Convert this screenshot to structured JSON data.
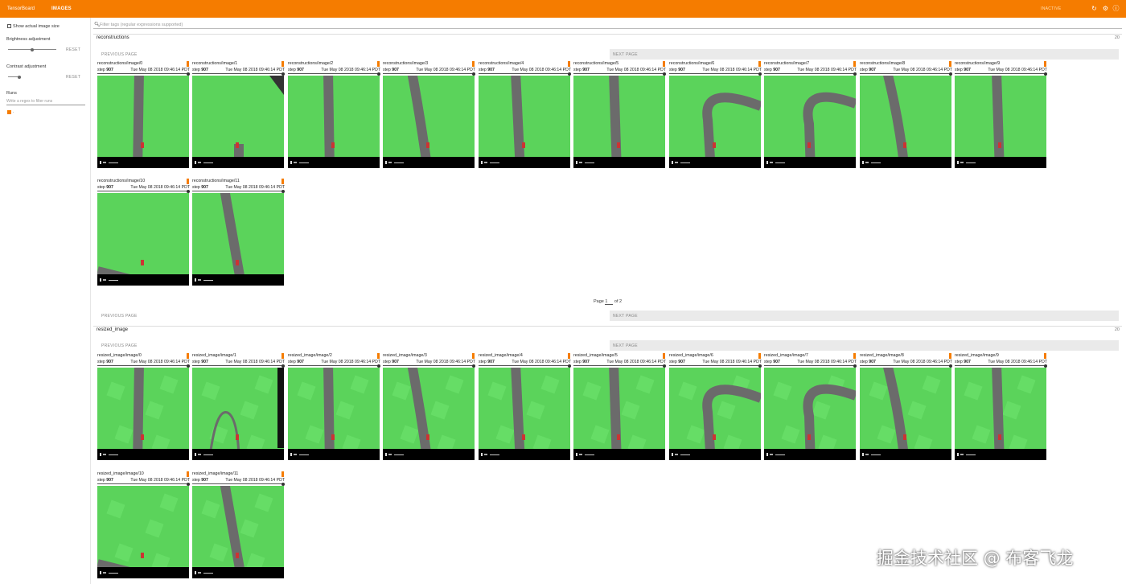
{
  "topbar": {
    "brand": "TensorBoard",
    "active_tab": "IMAGES",
    "inactive_label": "INACTIVE",
    "refresh_icon": "refresh-icon",
    "settings_icon": "gear-icon",
    "help_icon": "help-icon"
  },
  "sidebar": {
    "show_actual_size": "Show actual image size",
    "brightness_label": "Brightness adjustment",
    "brightness_reset": "RESET",
    "brightness_value": 0.5,
    "contrast_label": "Contrast adjustment",
    "contrast_reset": "RESET",
    "contrast_value": 0.5,
    "runs_label": "Runs",
    "runs_placeholder": "Write a regex to filter runs",
    "run_name": "."
  },
  "filter": {
    "placeholder": "Filter tags (regular expressions supported)"
  },
  "sections": [
    {
      "title": "reconstructions",
      "count": "20",
      "previous": "PREVIOUS PAGE",
      "next": "NEXT PAGE",
      "cards": [
        {
          "tag": "reconstructions/image/0",
          "step_label": "step",
          "step": "907",
          "time": "Tue May 08 2018 09:46:14 PDT"
        },
        {
          "tag": "reconstructions/image/1",
          "step_label": "step",
          "step": "907",
          "time": "Tue May 08 2018 09:46:14 PDT"
        },
        {
          "tag": "reconstructions/image/2",
          "step_label": "step",
          "step": "907",
          "time": "Tue May 08 2018 09:46:14 PDT"
        },
        {
          "tag": "reconstructions/image/3",
          "step_label": "step",
          "step": "907",
          "time": "Tue May 08 2018 09:46:14 PDT"
        },
        {
          "tag": "reconstructions/image/4",
          "step_label": "step",
          "step": "907",
          "time": "Tue May 08 2018 09:46:14 PDT"
        },
        {
          "tag": "reconstructions/image/5",
          "step_label": "step",
          "step": "907",
          "time": "Tue May 08 2018 09:46:14 PDT"
        },
        {
          "tag": "reconstructions/image/6",
          "step_label": "step",
          "step": "907",
          "time": "Tue May 08 2018 09:46:14 PDT"
        },
        {
          "tag": "reconstructions/image/7",
          "step_label": "step",
          "step": "907",
          "time": "Tue May 08 2018 09:46:14 PDT"
        },
        {
          "tag": "reconstructions/image/8",
          "step_label": "step",
          "step": "907",
          "time": "Tue May 08 2018 09:46:14 PDT"
        },
        {
          "tag": "reconstructions/image/9",
          "step_label": "step",
          "step": "907",
          "time": "Tue May 08 2018 09:46:14 PDT"
        },
        {
          "tag": "reconstructions/image/10",
          "step_label": "step",
          "step": "907",
          "time": "Tue May 08 2018 09:46:14 PDT"
        },
        {
          "tag": "reconstructions/image/11",
          "step_label": "step",
          "step": "907",
          "time": "Tue May 08 2018 09:46:14 PDT"
        }
      ],
      "bottom_previous": "PREVIOUS PAGE",
      "bottom_next": "NEXT PAGE"
    },
    {
      "title": "resized_image",
      "count": "20",
      "previous": "PREVIOUS PAGE",
      "next": "NEXT PAGE",
      "cards": [
        {
          "tag": "resized_image/image/0",
          "step_label": "step",
          "step": "907",
          "time": "Tue May 08 2018 09:46:14 PDT"
        },
        {
          "tag": "resized_image/image/1",
          "step_label": "step",
          "step": "907",
          "time": "Tue May 08 2018 09:46:14 PDT"
        },
        {
          "tag": "resized_image/image/2",
          "step_label": "step",
          "step": "907",
          "time": "Tue May 08 2018 09:46:14 PDT"
        },
        {
          "tag": "resized_image/image/3",
          "step_label": "step",
          "step": "907",
          "time": "Tue May 08 2018 09:46:14 PDT"
        },
        {
          "tag": "resized_image/image/4",
          "step_label": "step",
          "step": "907",
          "time": "Tue May 08 2018 09:46:14 PDT"
        },
        {
          "tag": "resized_image/image/5",
          "step_label": "step",
          "step": "907",
          "time": "Tue May 08 2018 09:46:14 PDT"
        },
        {
          "tag": "resized_image/image/6",
          "step_label": "step",
          "step": "907",
          "time": "Tue May 08 2018 09:46:14 PDT"
        },
        {
          "tag": "resized_image/image/7",
          "step_label": "step",
          "step": "907",
          "time": "Tue May 08 2018 09:46:14 PDT"
        },
        {
          "tag": "resized_image/image/8",
          "step_label": "step",
          "step": "907",
          "time": "Tue May 08 2018 09:46:14 PDT"
        },
        {
          "tag": "resized_image/image/9",
          "step_label": "step",
          "step": "907",
          "time": "Tue May 08 2018 09:46:14 PDT"
        },
        {
          "tag": "resized_image/image/10",
          "step_label": "step",
          "step": "907",
          "time": "Tue May 08 2018 09:46:14 PDT"
        },
        {
          "tag": "resized_image/image/11",
          "step_label": "step",
          "step": "907",
          "time": "Tue May 08 2018 09:46:14 PDT"
        }
      ]
    }
  ],
  "pagination": {
    "label": "Page",
    "current": "1",
    "of_label": "of 2"
  },
  "colors": {
    "accent": "#f57c00",
    "grass": "#5bd35b",
    "road": "#6b6b6b"
  },
  "watermark": "掘金技术社区 @ 布客飞龙"
}
